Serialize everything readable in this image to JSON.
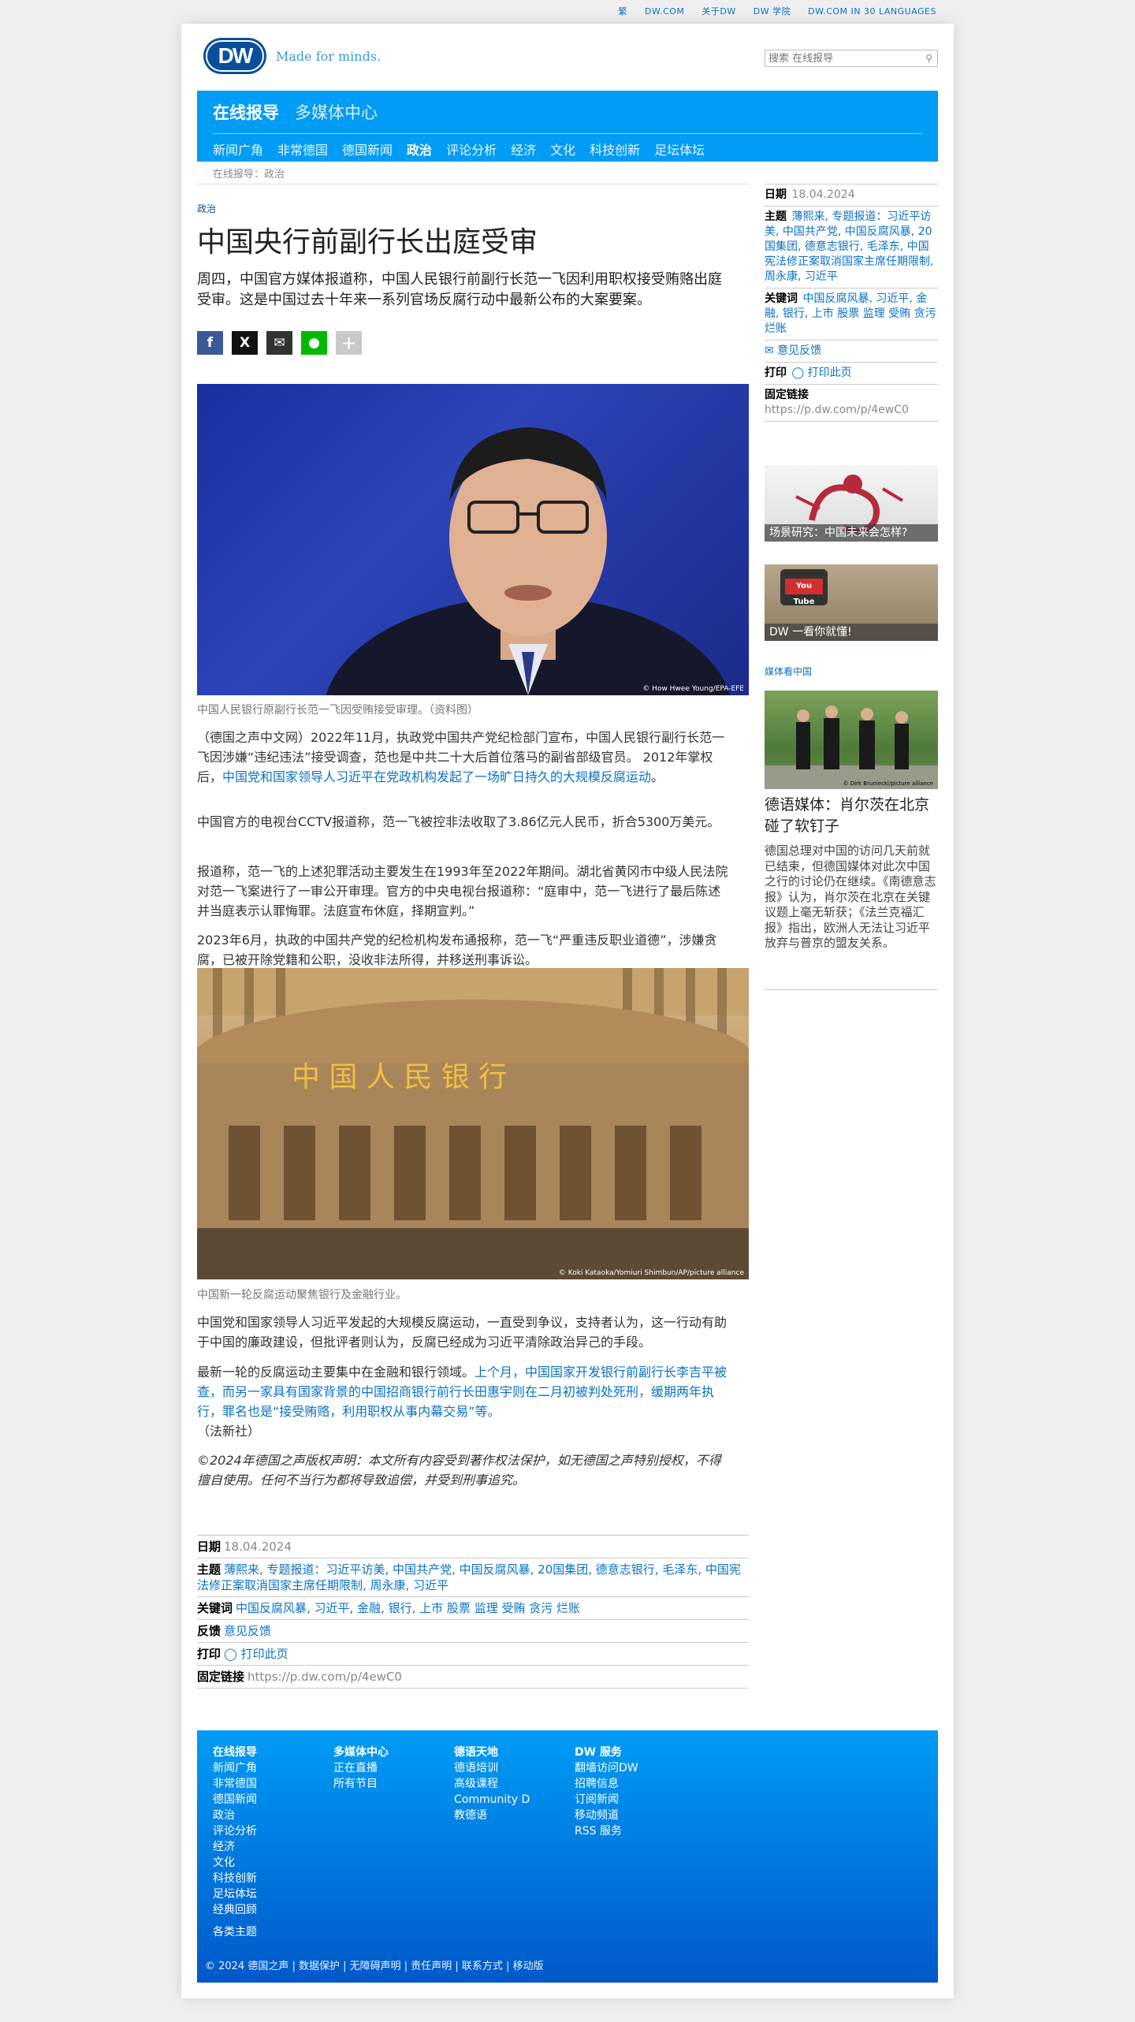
{
  "utility_bar": [
    "繁",
    "DW.COM",
    "关于DW",
    "DW 学院",
    "DW.COM IN 30 LANGUAGES"
  ],
  "header": {
    "logo": "DW",
    "tagline": "Made for minds.",
    "search_placeholder": "搜索 在线报导"
  },
  "nav": {
    "primary": "在线报导",
    "secondary": "多媒体中心",
    "items": [
      "新闻广角",
      "非常德国",
      "德国新闻",
      "政治",
      "评论分析",
      "经济",
      "文化",
      "科技创新",
      "足坛体坛"
    ],
    "active": "政治"
  },
  "breadcrumb": "在线报导：政治",
  "article": {
    "kicker": "政治",
    "title": "中国央行前副行长出庭受审",
    "lead": "周四，中国官方媒体报道称，中国人民银行前副行长范一飞因利用职权接受贿赂出庭受审。这是中国过去十年来一系列官场反腐行动中最新公布的大案要案。",
    "photo1_credit": "© How Hwee Young/EPA-EFE",
    "photo1_caption": "中国人民银行原副行长范一飞因受贿接受审理。（资料图）",
    "p1_text": "（德国之声中文网）2022年11月，执政党中国共产党纪检部门宣布，中国人民银行副行长范一飞因涉嫌“违纪违法”接受调查，范也是中共二十大后首位落马的副省部级官员。 2012年掌权后，",
    "p1_link": "中国党和国家领导人习近平在党政机构发起了一场旷日持久的大规模反腐运动",
    "p1_end": "。",
    "p2": "中国官方的电视台CCTV报道称，范一飞被控非法收取了3.86亿元人民币，折合5300万美元。",
    "p3": "报道称，范一飞的上述犯罪活动主要发生在1993年至2022年期间。湖北省黄冈市中级人民法院对范一飞案进行了一审公开审理。官方的中央电视台报道称：“庭审中，范一飞进行了最后陈述并当庭表示认罪悔罪。法庭宣布休庭，择期宣判。”",
    "p4": "2023年6月，执政的中国共产党的纪检机构发布通报称，范一飞“严重违反职业道德”，涉嫌贪腐，已被开除党籍和公职，没收非法所得，并移送刑事诉讼。",
    "photo2_sign": "中 国 人 民 银 行",
    "photo2_credit": "© Koki Kataoka/Yomiuri Shimbun/AP/picture alliance",
    "photo2_caption": "中国新一轮反腐运动聚焦银行及金融行业。",
    "p5": "中国党和国家领导人习近平发起的大规模反腐运动，一直受到争议，支持者认为，这一行动有助于中国的廉政建设，但批评者则认为，反腐已经成为习近平清除政治异己的手段。",
    "p6_text": "最新一轮的反腐运动主要集中在金融和银行领域。",
    "p6_link": "上个月，中国国家开发银行前副行长李吉平被查，而另一家具有国家背景的中国招商银行前行长田惠宇则在二月初被判处死刑，缓期两年执行，罪名也是“接受贿赂，利用职权从事内幕交易”等。",
    "p6_source": "（法新社）",
    "copyright": "©2024年德国之声版权声明：本文所有内容受到著作权法保护，如无德国之声特别授权，不得擅自使用。任何不当行为都将导致追偿，并受到刑事追究。"
  },
  "info": {
    "date_label": "日期",
    "date": "18.04.2024",
    "topics_label": "主题",
    "topics": "薄熙来, 专题报道：习近平访美, 中国共产党, 中国反腐风暴, 20国集团, 德意志银行, 毛泽东, 中国宪法修正案取消国家主席任期限制, 周永康, 习近平",
    "keywords_label": "关键词",
    "keywords": "中国反腐风暴, 习近平, 金融, 银行, 上市 股票 监理 受贿 贪污 烂账",
    "feedback_label": "反馈",
    "feedback": "意见反馈",
    "print_label": "打印",
    "print": "打印此页",
    "permalink_label": "固定链接",
    "permalink": "https://p.dw.com/p/4ewC0"
  },
  "sidebar": {
    "date_label": "日期",
    "date": "18.04.2024",
    "topics_label": "主题",
    "topics": "薄熙来, 专题报道：习近平访美, 中国共产党, 中国反腐风暴, 20国集团, 德意志银行, 毛泽东, 中国宪法修正案取消国家主席任期限制, 周永康, 习近平",
    "keywords_label": "关键词",
    "keywords": "中国反腐风暴, 习近平, 金融, 银行, 上市 股票 监理 受贿 贪污 烂账",
    "feedback": "意见反馈",
    "print_label": "打印",
    "print": "打印此页",
    "permalink_label": "固定链接",
    "permalink": "https://p.dw.com/p/4ewC0",
    "teaser1": "场景研究：中国未来会怎样?",
    "teaser2": "DW 一看你就懂!",
    "teaser2_logo": "You Tube",
    "media_label": "媒体看中国",
    "story_credit": "© Dirk Bruniecki/picture alliance",
    "story_title": "德语媒体：肖尔茨在北京碰了软钉子",
    "story_text": "德国总理对中国的访问几天前就已结束，但德国媒体对此次中国之行的讨论仍在继续。《南德意志报》认为，肖尔茨在北京在关键议题上毫无斩获；《法兰克福汇报》指出，欧洲人无法让习近平放弃与普京的盟友关系。"
  },
  "footer": {
    "col1_head": "在线报导",
    "col1": [
      "新闻广角",
      "非常德国",
      "德国新闻",
      "政治",
      "评论分析",
      "经济",
      "文化",
      "科技创新",
      "足坛体坛",
      "经典回顾"
    ],
    "col2_head": "多媒体中心",
    "col2": [
      "正在直播",
      "所有节目"
    ],
    "col3_head": "德语天地",
    "col3": [
      "德语培训",
      "高级课程",
      "Community D",
      "教德语"
    ],
    "col4_head": "DW 服务",
    "col4": [
      "翻墙访问DW",
      "招聘信息",
      "订阅新闻",
      "移动频道",
      "RSS 服务"
    ],
    "topics": "各类主题",
    "bottom": "© 2024 德国之声 | 数据保护 | 无障碍声明 | 责任声明 | 联系方式 | 移动版"
  },
  "colors": {
    "brand_blue": "#009cf5",
    "link": "#0a72c4",
    "logo": "#0a4f9c"
  }
}
